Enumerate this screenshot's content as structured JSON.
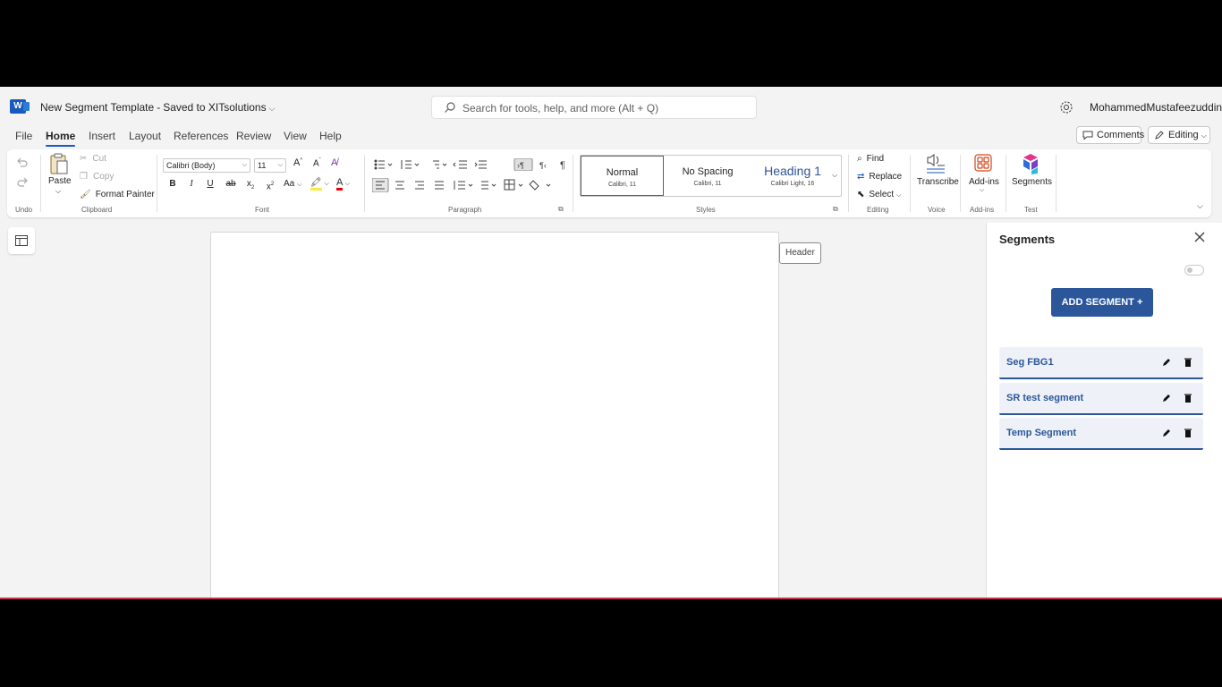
{
  "titlebar": {
    "doc_name": "New Segment Template",
    "separator": "-",
    "save_status": "Saved to XITsolutions",
    "search_placeholder": "Search for tools, help, and more (Alt + Q)",
    "user_name": "MohammedMustafeezuddin"
  },
  "menu": {
    "tabs": [
      "File",
      "Home",
      "Insert",
      "Layout",
      "References",
      "Review",
      "View",
      "Help"
    ],
    "active_tab": "Home",
    "comments_label": "Comments",
    "editing_label": "Editing"
  },
  "ribbon": {
    "groups": {
      "undo": "Undo",
      "clipboard": "Clipboard",
      "font": "Font",
      "paragraph": "Paragraph",
      "styles": "Styles",
      "editing": "Editing",
      "voice": "Voice",
      "addins": "Add-ins",
      "test": "Test"
    },
    "clipboard": {
      "paste": "Paste",
      "cut": "Cut",
      "copy": "Copy",
      "format_painter": "Format Painter"
    },
    "font": {
      "name": "Calibri (Body)",
      "size": "11",
      "bold": "B",
      "italic": "I",
      "underline": "U",
      "strike": "ab",
      "case": "Aa"
    },
    "styles": [
      {
        "name": "Normal",
        "sub": "Calibri, 11"
      },
      {
        "name": "No Spacing",
        "sub": "Calibri, 11"
      },
      {
        "name": "Heading 1",
        "sub": "Calibri Light, 16"
      }
    ],
    "editing": {
      "find": "Find",
      "replace": "Replace",
      "select": "Select"
    },
    "voice": {
      "transcribe": "Transcribe"
    },
    "addins": {
      "addins": "Add-ins"
    },
    "test": {
      "segments": "Segments"
    }
  },
  "document": {
    "header_tag": "Header"
  },
  "segments_pane": {
    "title": "Segments",
    "add_button": "ADD SEGMENT  +",
    "items": [
      "Seg FBG1",
      "SR test segment",
      "Temp Segment"
    ],
    "accent_color": "#2b579a"
  }
}
